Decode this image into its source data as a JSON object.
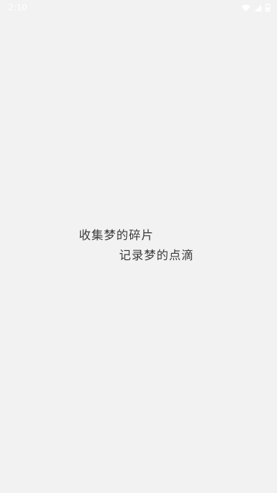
{
  "status_bar": {
    "time": "2:10",
    "icons": [
      "wifi-icon",
      "cellular-signal-icon",
      "battery-icon"
    ]
  },
  "splash": {
    "line_1": "收集梦的碎片",
    "line_2": "记录梦的点滴"
  },
  "colors": {
    "background": "#f2f2f2",
    "text": "#3a3a3a",
    "status_bar_text": "#ffffff"
  }
}
